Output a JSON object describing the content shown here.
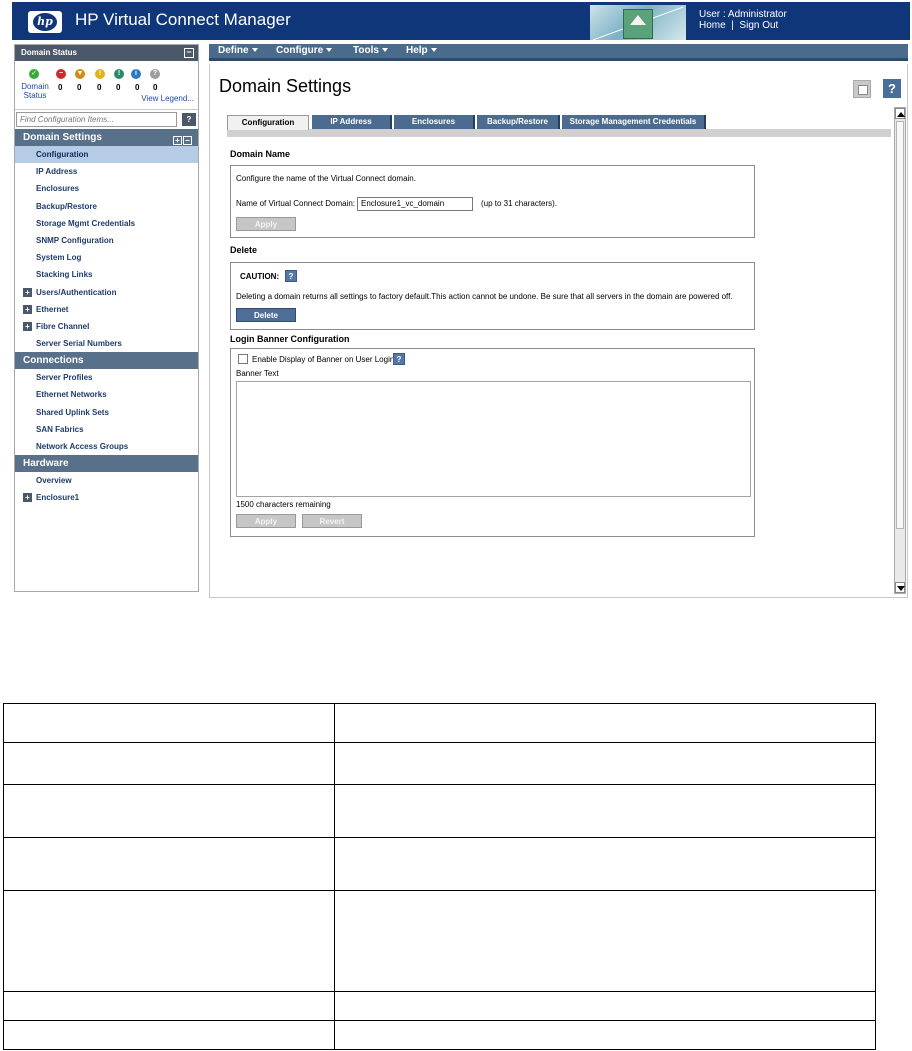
{
  "header": {
    "logo_text": "hp",
    "title": "HP Virtual Connect Manager",
    "user_line": "User : Administrator",
    "home_link": "Home",
    "separator": "|",
    "signout_link": "Sign Out"
  },
  "domain_status": {
    "title": "Domain Status",
    "collapse_glyph": "−",
    "label": "Domain Status",
    "counts": [
      "0",
      "0",
      "0",
      "0",
      "0",
      "0"
    ],
    "view_legend": "View Legend...",
    "icons": [
      {
        "name": "ok-icon",
        "color": "#3aa83a",
        "glyph": "✓"
      },
      {
        "name": "critical-icon",
        "color": "#cc2b2b",
        "glyph": "−"
      },
      {
        "name": "major-icon",
        "color": "#d08a1a",
        "glyph": "▼"
      },
      {
        "name": "minor-warning-icon",
        "color": "#e2b21b",
        "glyph": "!"
      },
      {
        "name": "warning-icon",
        "color": "#2f8a6a",
        "glyph": "!"
      },
      {
        "name": "info-icon",
        "color": "#2f79c4",
        "glyph": "i"
      },
      {
        "name": "unknown-icon",
        "color": "#9c9c9c",
        "glyph": "?"
      }
    ]
  },
  "search": {
    "placeholder": "Find Configuration Items...",
    "help_glyph": "?"
  },
  "sidebar": {
    "sections": [
      {
        "title": "Domain Settings",
        "items": [
          {
            "label": "Configuration",
            "selected": true
          },
          {
            "label": "IP Address"
          },
          {
            "label": "Enclosures"
          },
          {
            "label": "Backup/Restore"
          },
          {
            "label": "Storage Mgmt Credentials"
          },
          {
            "label": "SNMP Configuration"
          },
          {
            "label": "System Log"
          },
          {
            "label": "Stacking Links"
          },
          {
            "label": "Users/Authentication",
            "expandable": true
          },
          {
            "label": "Ethernet",
            "expandable": true
          },
          {
            "label": "Fibre Channel",
            "expandable": true
          },
          {
            "label": "Server Serial Numbers"
          }
        ]
      },
      {
        "title": "Connections",
        "items": [
          {
            "label": "Server Profiles"
          },
          {
            "label": "Ethernet Networks"
          },
          {
            "label": "Shared Uplink Sets"
          },
          {
            "label": "SAN Fabrics"
          },
          {
            "label": "Network Access Groups"
          }
        ]
      },
      {
        "title": "Hardware",
        "items": [
          {
            "label": "Overview"
          },
          {
            "label": "Enclosure1",
            "expandable": true
          }
        ]
      }
    ]
  },
  "menu": [
    "Define",
    "Configure",
    "Tools",
    "Help"
  ],
  "page": {
    "title": "Domain Settings",
    "help_glyph": "?",
    "tabs": [
      {
        "label": "Configuration",
        "active": true
      },
      {
        "label": "IP Address"
      },
      {
        "label": "Enclosures"
      },
      {
        "label": "Backup/Restore"
      },
      {
        "label": "Storage Management Credentials"
      }
    ],
    "domain_name": {
      "title": "Domain Name",
      "description": "Configure the name of the Virtual Connect domain.",
      "field_label": "Name of Virtual Connect Domain:",
      "field_value": "Enclosure1_vc_domain",
      "hint": "(up to 31 characters).",
      "apply": "Apply"
    },
    "delete": {
      "title": "Delete",
      "caution": "CAUTION:",
      "help_glyph": "?",
      "warning": "Deleting a domain returns all settings to factory default.This action cannot be undone. Be sure that all servers in the domain are powered off.",
      "button": "Delete"
    },
    "login_banner": {
      "title": "Login Banner Configuration",
      "checkbox_label": "Enable Display of Banner on User Login",
      "help_glyph": "?",
      "banner_label": "Banner Text",
      "remaining": "1500 characters remaining",
      "apply": "Apply",
      "revert": "Revert"
    }
  }
}
